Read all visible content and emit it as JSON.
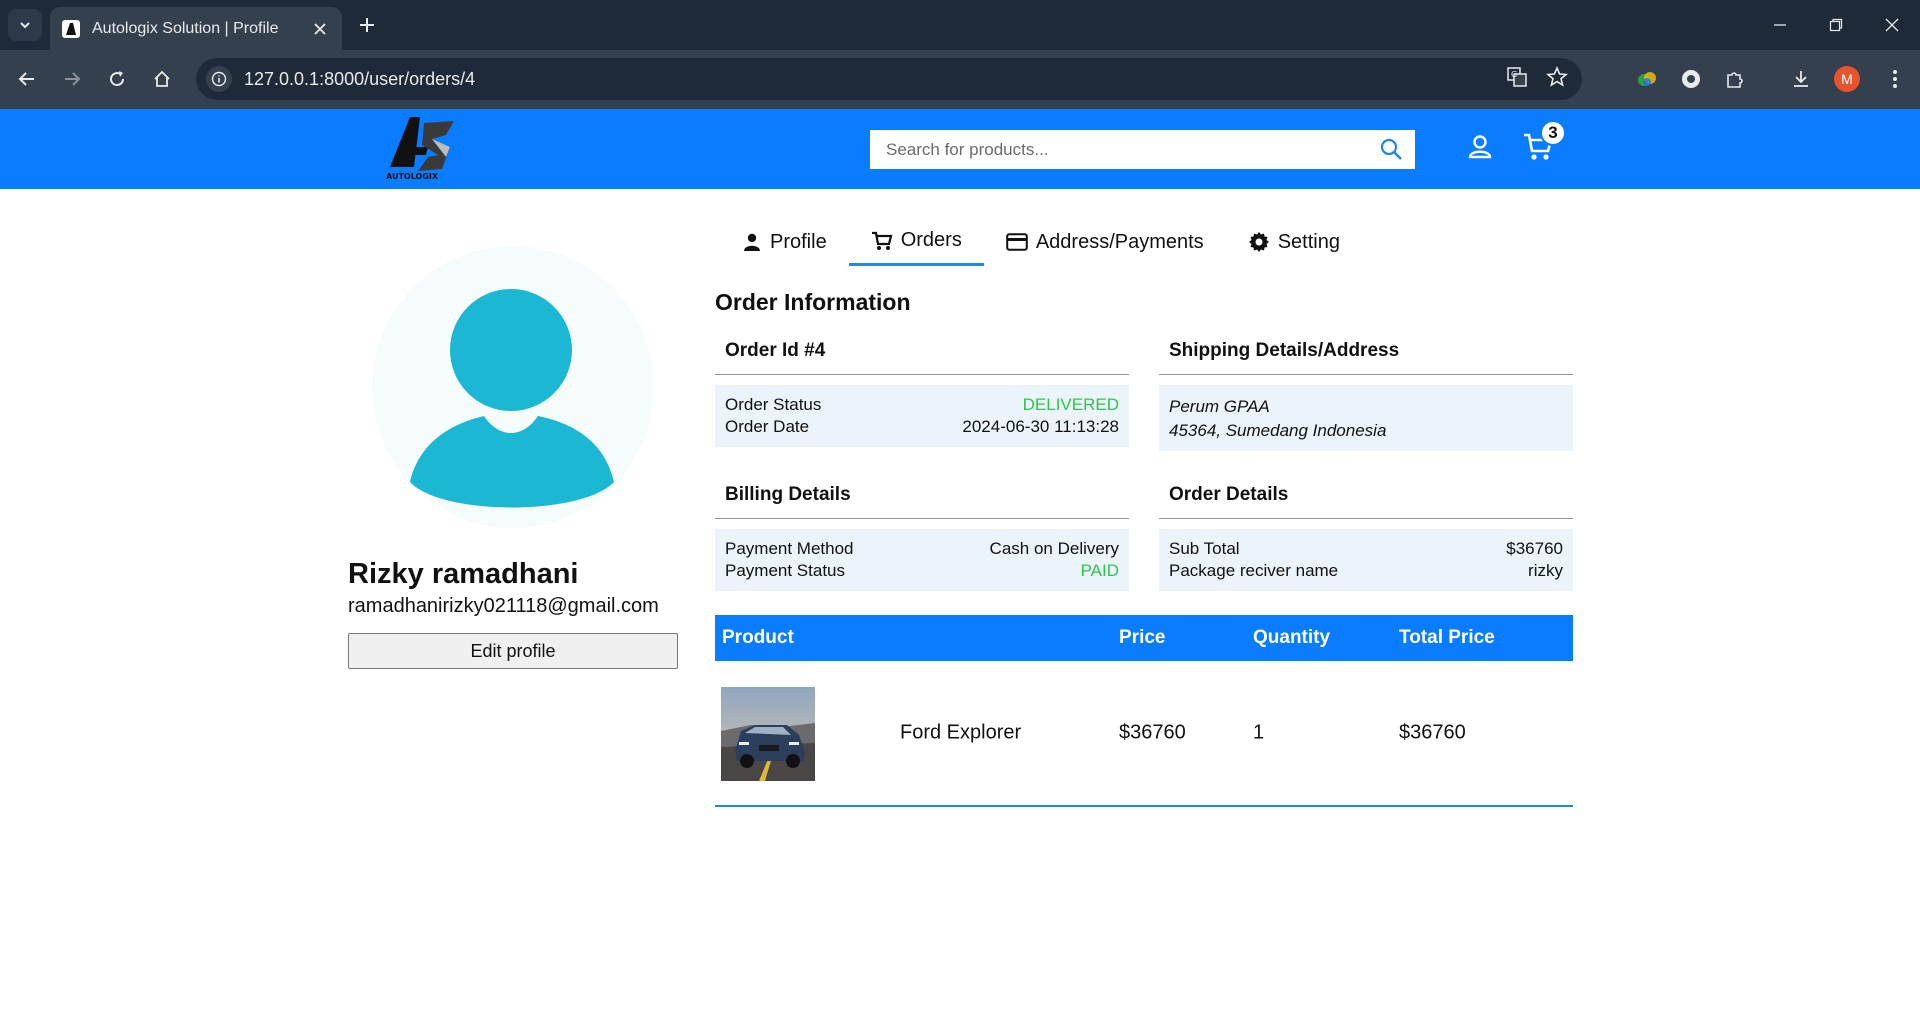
{
  "browser": {
    "tab_title": "Autologix Solution | Profile",
    "url": "127.0.0.1:8000/user/orders/4",
    "profile_initial": "M"
  },
  "header": {
    "logo_text": "AUTOLOGIX",
    "search_placeholder": "Search for products...",
    "cart_count": "3"
  },
  "profile": {
    "name": "Rizky ramadhani",
    "email": "ramadhanirizky021118@gmail.com",
    "edit_label": "Edit profile"
  },
  "tabs": [
    {
      "label": "Profile",
      "icon": "person-icon"
    },
    {
      "label": "Orders",
      "icon": "cart-icon",
      "active": true
    },
    {
      "label": "Address/Payments",
      "icon": "card-icon"
    },
    {
      "label": "Setting",
      "icon": "gear-icon"
    }
  ],
  "order": {
    "heading": "Order Information",
    "id_title": "Order Id #4",
    "status_label": "Order Status",
    "status_value": "DELIVERED",
    "date_label": "Order Date",
    "date_value": "2024-06-30 11:13:28",
    "shipping_title": "Shipping Details/Address",
    "address_line1": "Perum GPAA",
    "address_line2": "45364, Sumedang Indonesia",
    "billing_title": "Billing Details",
    "payment_method_label": "Payment Method",
    "payment_method_value": "Cash on Delivery",
    "payment_status_label": "Payment Status",
    "payment_status_value": "PAID",
    "details_title": "Order Details",
    "subtotal_label": "Sub Total",
    "subtotal_value": "$36760",
    "receiver_label": "Package reciver name",
    "receiver_value": "rizky"
  },
  "table": {
    "headers": [
      "Product",
      "Price",
      "Quantity",
      "Total Price"
    ],
    "rows": [
      {
        "name": "Ford Explorer",
        "price": "$36760",
        "quantity": "1",
        "total": "$36760"
      }
    ]
  },
  "colors": {
    "brand_blue": "#0a7cff",
    "status_green": "#30c44a",
    "avatar_teal": "#1bb7d3"
  }
}
